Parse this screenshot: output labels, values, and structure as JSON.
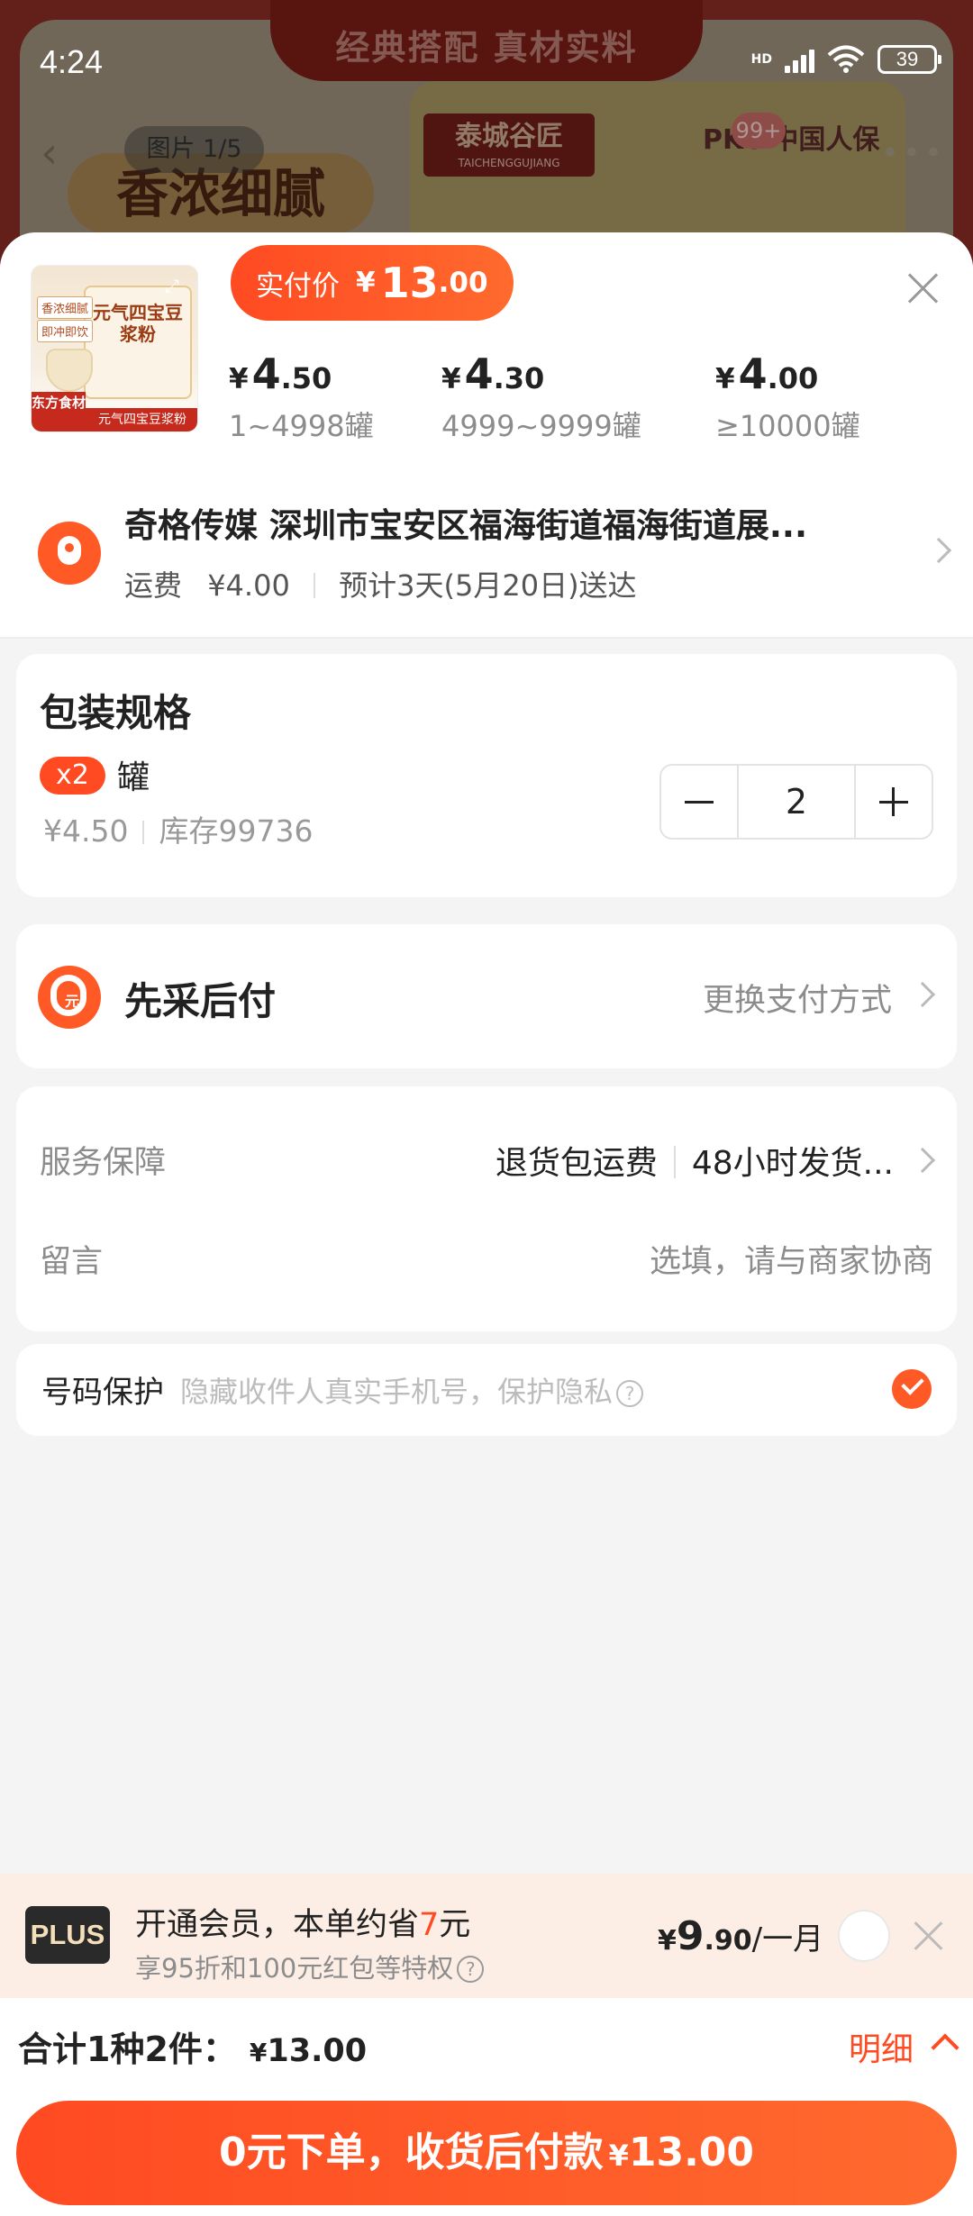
{
  "status_bar": {
    "time": "4:24",
    "network": "HD",
    "battery": "39"
  },
  "background": {
    "banner": "经典搭配 真材实料",
    "image_counter": "图片 1/5",
    "pill_text": "香浓细腻",
    "can_brand": "泰城谷匠",
    "can_brand_en": "TAICHENGGUJIANG",
    "pkc_text": "PKC 中国人保",
    "badge": "99+"
  },
  "product": {
    "thumb_title": "元气四宝豆浆粉",
    "thumb_tag": "东方食材",
    "thumb_bottom": "元气四宝豆浆粉",
    "thumb_left1": "香浓细腻",
    "thumb_left2": "即冲即饮"
  },
  "price": {
    "label": "实付价",
    "currency": "¥",
    "integer": "13",
    "decimal": ".00"
  },
  "tiers": [
    {
      "currency": "¥",
      "integer": "4",
      "decimal": ".50",
      "range": "1~4998罐"
    },
    {
      "currency": "¥",
      "integer": "4",
      "decimal": ".30",
      "range": "4999~9999罐"
    },
    {
      "currency": "¥",
      "integer": "4",
      "decimal": ".00",
      "range": "≥10000罐"
    }
  ],
  "address": {
    "line1": "奇格传媒 深圳市宝安区福海街道福海街道展...",
    "shipping_label": "运费",
    "shipping_fee": "¥4.00",
    "eta": "预计3天(5月20日)送达"
  },
  "spec": {
    "title": "包装规格",
    "multiplier": "x2",
    "unit": "罐",
    "unit_price": "¥4.50",
    "stock": "库存99736",
    "quantity": "2"
  },
  "payment": {
    "title": "先采后付",
    "change_link": "更换支付方式"
  },
  "service": {
    "label": "服务保障",
    "item1": "退货包运费",
    "item2": "48小时发货...",
    "message_label": "留言",
    "message_placeholder": "选填，请与商家协商"
  },
  "privacy": {
    "label": "号码保护",
    "hint": "隐藏收件人真实手机号，保护隐私",
    "help": "?",
    "checked": true
  },
  "plus": {
    "logo": "PLUS",
    "line1_prefix": "开通会员，本单约省",
    "line1_amount": "7",
    "line1_suffix": "元",
    "line2": "享95折和100元红包等特权",
    "help": "?",
    "price_currency": "¥",
    "price_integer": "9",
    "price_decimal": ".90",
    "price_unit": "/一月"
  },
  "total": {
    "label": "合计1种2件：",
    "currency": "¥",
    "amount": "13.00",
    "detail_link": "明细"
  },
  "cta": {
    "label": "0元下单，收货后付款",
    "currency": "¥",
    "amount": "13.00"
  },
  "colors": {
    "accent": "#ff4a22",
    "plus_bg": "#fdeee5",
    "page_bg": "#f4f4f4"
  }
}
